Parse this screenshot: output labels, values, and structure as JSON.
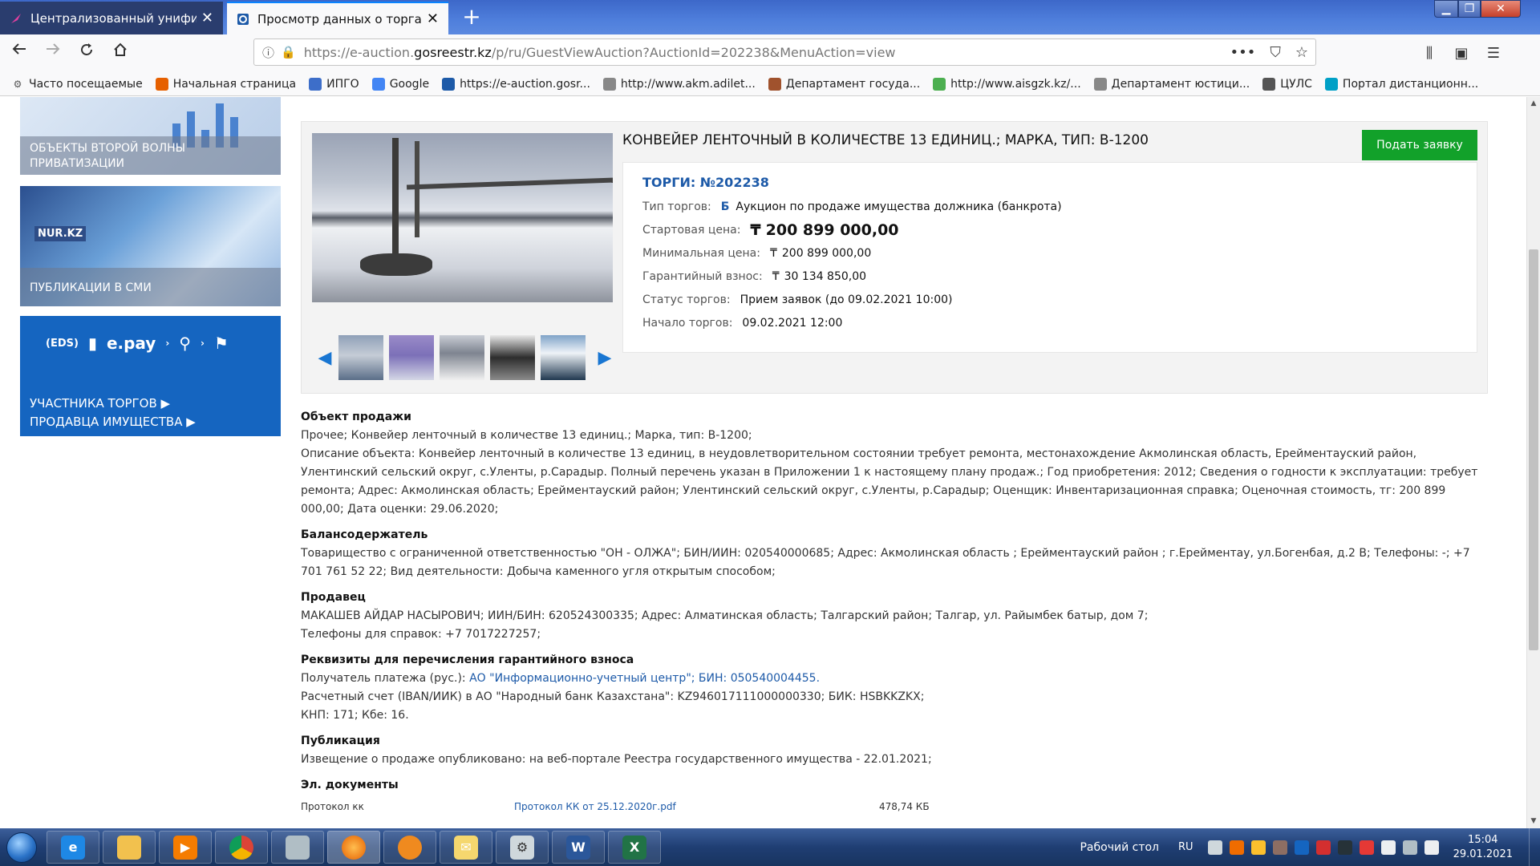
{
  "browser": {
    "tabs": [
      {
        "title": "Централизованный унифици",
        "active": false
      },
      {
        "title": "Просмотр данных о торгах",
        "active": true
      }
    ],
    "url_prefix": "https://e-auction.",
    "url_domain": "gosreestr.kz",
    "url_rest": "/p/ru/GuestViewAuction?AuctionId=202238&MenuAction=view",
    "bookmarks": [
      {
        "label": "Часто посещаемые",
        "icon": "gear-icon",
        "color": "#555"
      },
      {
        "label": "Начальная страница",
        "icon": "firefox-icon",
        "color": "#e66000"
      },
      {
        "label": "ИПГО",
        "icon": "page-icon",
        "color": "#3d6ec9"
      },
      {
        "label": "Google",
        "icon": "google-icon",
        "color": "#4285f4"
      },
      {
        "label": "https://e-auction.gosr...",
        "icon": "gosreestr-icon",
        "color": "#1d5aa8"
      },
      {
        "label": "http://www.akm.adilet...",
        "icon": "emblem-icon",
        "color": "#888"
      },
      {
        "label": "Департамент госуда...",
        "icon": "emblem-icon",
        "color": "#a0522d"
      },
      {
        "label": "http://www.aisgzk.kz/...",
        "icon": "globe-icon",
        "color": "#4caf50"
      },
      {
        "label": "Департамент юстици...",
        "icon": "emblem-icon",
        "color": "#888"
      },
      {
        "label": "ЦУЛС",
        "icon": "globe-icon",
        "color": "#555"
      },
      {
        "label": "Портал дистанционн...",
        "icon": "flag-icon",
        "color": "#00a0c6"
      }
    ]
  },
  "sidebar": {
    "banner1": {
      "line1": "ОБЪЕКТЫ ВТОРОЙ ВОЛНЫ",
      "line2": "ПРИВАТИЗАЦИИ"
    },
    "banner2": {
      "label": "ПУБЛИКАЦИИ В СМИ",
      "logo": "NUR.KZ"
    },
    "banner3": {
      "eds": "(EDS)",
      "epay": "e.pay",
      "link1": "УЧАСТНИКА ТОРГОВ ▶",
      "link2": "ПРОДАВЦА ИМУЩЕСТВА ▶"
    }
  },
  "auction": {
    "title": "КОНВЕЙЕР ЛЕНТОЧНЫЙ В КОЛИЧЕСТВЕ 13 ЕДИНИЦ.; МАРКА, ТИП: В-1200",
    "apply_button": "Подать заявку",
    "torgi": "ТОРГИ: №202238",
    "type_label": "Тип торгов:",
    "type_badge": "Б",
    "type_value": "Аукцион по продаже имущества должника (банкрота)",
    "start_price_label": "Стартовая цена:",
    "start_price": "200 899 000,00",
    "min_price_label": "Минимальная цена:",
    "min_price": "200 899 000,00",
    "guarantee_label": "Гарантийный взнос:",
    "guarantee": "30 134 850,00",
    "status_label": "Статус торгов:",
    "status": "Прием заявок (до 09.02.2021 10:00)",
    "start_label": "Начало торгов:",
    "start": "09.02.2021 12:00",
    "currency": "₸"
  },
  "details": {
    "object_heading": "Объект продажи",
    "object_line1": "Прочее; Конвейер ленточный в количестве 13 единиц.; Марка, тип: В-1200;",
    "object_line2": "Описание объекта: Конвейер ленточный в количестве 13 единиц, в неудовлетворительном состоянии требует ремонта, местонахождение Акмолинская область, Ерейментауский район, Улентинский сельский округ, с.Уленты, р.Сарадыр. Полный перечень указан в Приложении 1 к настоящему плану продаж.; Год приобретения: 2012; Сведения о годности к эксплуатации: требует ремонта; Адрес: Акмолинская область; Ерейментауский район; Улентинский сельский округ, с.Уленты, р.Сарадыр; Оценщик: Инвентаризационная справка; Оценочная стоимость, тг: 200 899 000,00; Дата оценки: 29.06.2020;",
    "holder_heading": "Балансодержатель",
    "holder_text": "Товарищество с ограниченной ответственностью \"ОН - ОЛЖА\"; БИН/ИИН: 020540000685; Адрес: Акмолинская область ; Ерейментауский район ; г.Ерейментау, ул.Богенбая, д.2 В; Телефоны: -; +7 701 761 52 22; Вид деятельности: Добыча каменного угля открытым способом;",
    "seller_heading": "Продавец",
    "seller_line1": "МАКАШЕВ АЙДАР НАСЫРОВИЧ; ИИН/БИН: 620524300335;  Адрес: Алматинская область; Талгарский район; Талгар, ул. Райымбек батыр, дом 7;",
    "seller_line2": "Телефоны для справок: +7 7017227257;",
    "req_heading": "Реквизиты для перечисления гарантийного взноса",
    "req_prefix": "Получатель платежа (рус.): ",
    "req_link": "АО \"Информационно-учетный центр\"; БИН: 050540004455.",
    "req_line2": "Расчетный счет (IBAN/ИИК) в АО \"Народный банк Казахстана\": KZ946017111000000330; БИК: HSBKKZKX;",
    "req_line3": "КНП: 171; Кбе: 16.",
    "pub_heading": "Публикация",
    "pub_text": "Извещение о продаже опубликовано: на веб-портале Реестра государственного имущества - 22.01.2021;",
    "docs_heading": "Эл. документы",
    "doc": {
      "name": "Протокол кк",
      "file": "Протокол КК от 25.12.2020г.pdf",
      "size": "478,74 КБ"
    }
  },
  "taskbar": {
    "desktop_label": "Рабочий стол",
    "lang": "RU",
    "time": "15:04",
    "date": "29.01.2021"
  }
}
